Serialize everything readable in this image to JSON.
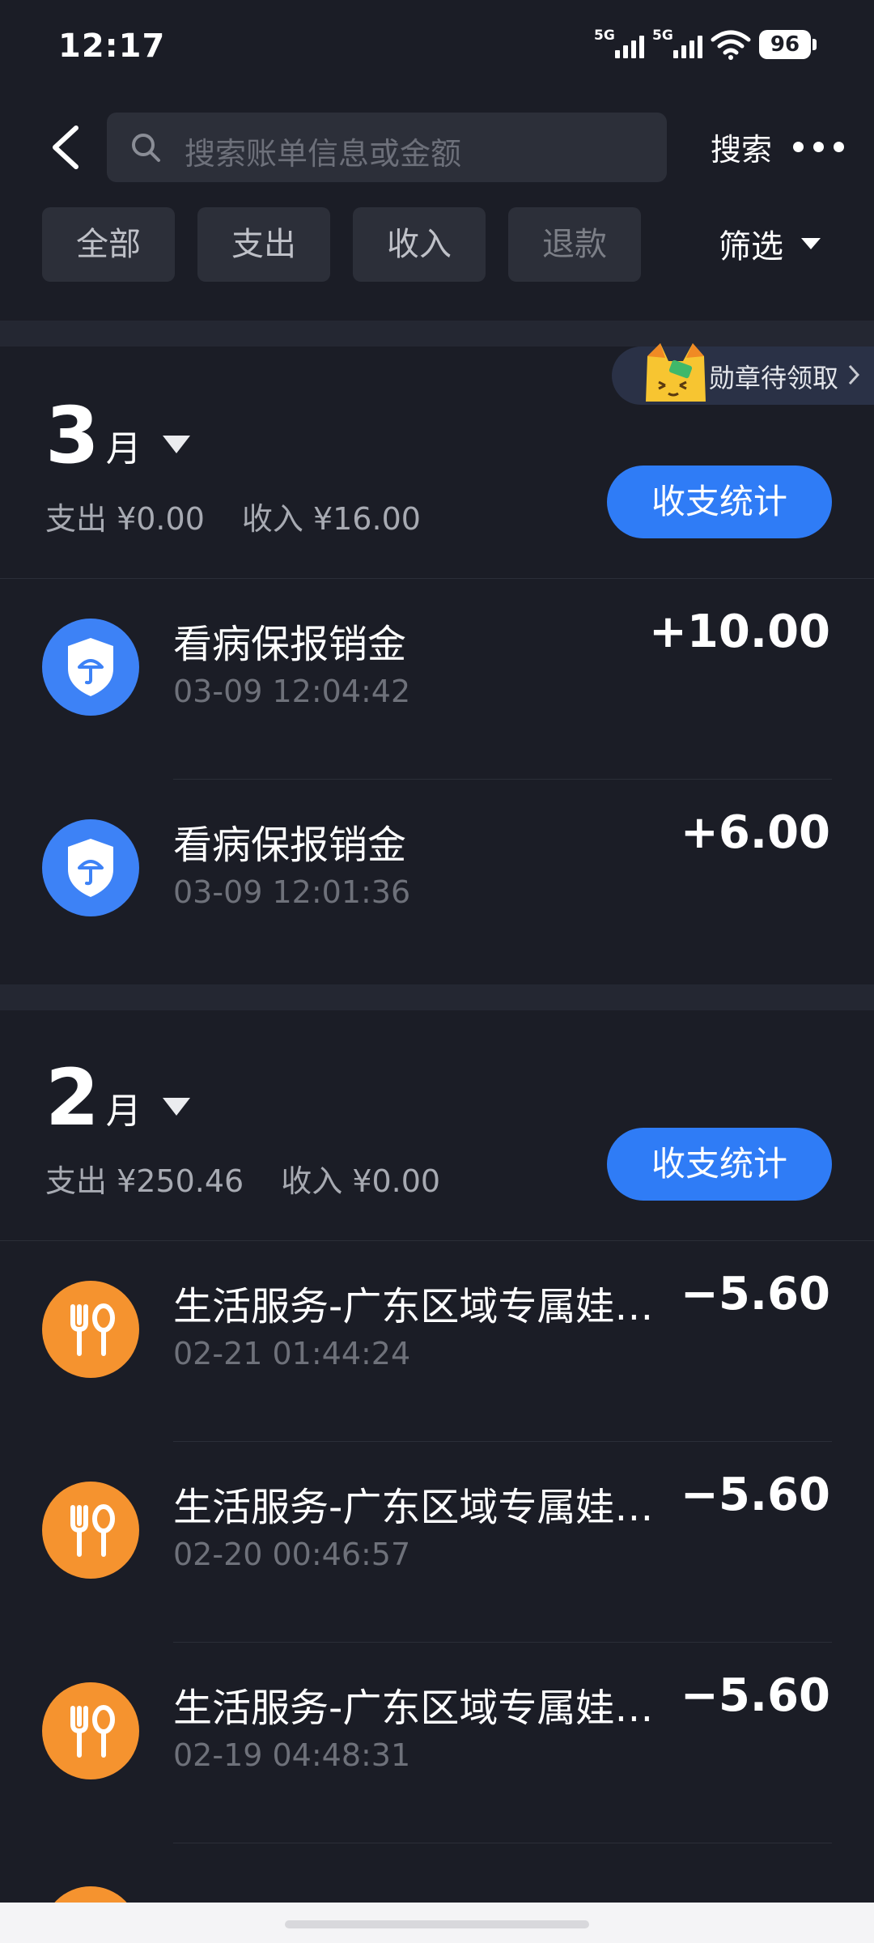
{
  "status_bar": {
    "time": "12:17",
    "battery": "96",
    "network1": "5G",
    "network2": "5G"
  },
  "header": {
    "search_placeholder": "搜索账单信息或金额",
    "search_button": "搜索"
  },
  "tabs": [
    "全部",
    "支出",
    "收入",
    "退款"
  ],
  "filter_label": "筛选",
  "badge_label": "勋章待领取",
  "sections": [
    {
      "month_num": "3",
      "month_unit": "月",
      "expense": "支出 ¥0.00",
      "income": "收入 ¥16.00",
      "stat_button": "收支统计",
      "items": [
        {
          "title": "看病保报销金",
          "time": "03-09 12:04:42",
          "amount": "+10.00",
          "icon": "shield-umbrella-icon"
        },
        {
          "title": "看病保报销金",
          "time": "03-09 12:01:36",
          "amount": "+6.00",
          "icon": "shield-umbrella-icon"
        }
      ]
    },
    {
      "month_num": "2",
      "month_unit": "月",
      "expense": "支出 ¥250.46",
      "income": "收入 ¥0.00",
      "stat_button": "收支统计",
      "items": [
        {
          "title": "生活服务-广东区域专属娃…",
          "time": "02-21 01:44:24",
          "amount": "−5.60",
          "icon": "fork-spoon-icon"
        },
        {
          "title": "生活服务-广东区域专属娃…",
          "time": "02-20 00:46:57",
          "amount": "−5.60",
          "icon": "fork-spoon-icon"
        },
        {
          "title": "生活服务-广东区域专属娃…",
          "time": "02-19 04:48:31",
          "amount": "−5.60",
          "icon": "fork-spoon-icon"
        }
      ]
    }
  ],
  "colors": {
    "background": "#1b1d26",
    "accent": "#2f7cf6",
    "income_icon": "#3d82f6",
    "expense_icon": "#f5932f"
  }
}
